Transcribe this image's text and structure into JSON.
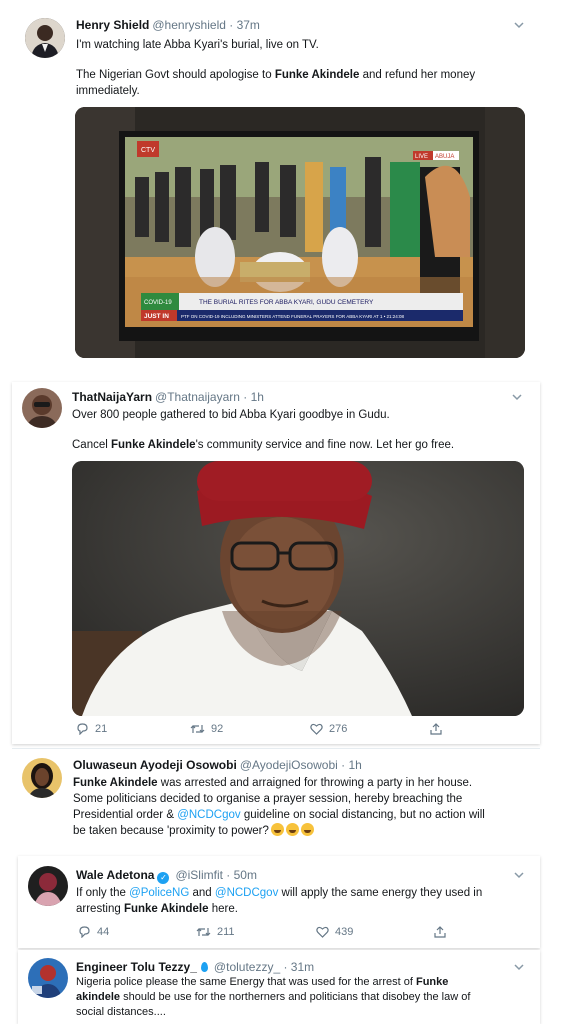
{
  "tweets": [
    {
      "name": "Henry Shield",
      "handle": "@henryshield · 37m",
      "p1": "I'm watching late Abba Kyari's burial, live on TV.",
      "p2_pre": "The Nigerian Govt should apologise to ",
      "p2_bold": "Funke Akindele",
      "p2_post": " and refund her money immediately.",
      "tv": {
        "channel": "CTV",
        "live_badge": "LIVE",
        "live_place": "ABUJA",
        "covid_tag": "COVID-19",
        "caption": "THE BURIAL RITES FOR ABBA KYARI, GUDU CEMETERY",
        "just_in": "JUST IN",
        "ticker": "PTF ON COVID-19 INCLUDING MINISTERS ATTEND FUNERAL PRAYERS FOR ABBA KYARI AT 1 • 21:24:08"
      }
    },
    {
      "name": "ThatNaijaYarn",
      "handle": "@Thatnaijayarn · 1h",
      "p1": "Over 800 people gathered to bid Abba Kyari goodbye in Gudu.",
      "p2_pre": "Cancel ",
      "p2_bold": "Funke Akindele",
      "p2_post": "'s community service and fine now. Let her go free.",
      "replies": "21",
      "retweets": "92",
      "likes": "276"
    },
    {
      "name": "Oluwaseun Ayodeji Osowobi",
      "handle": "@AyodejiOsowobi · 1h",
      "l1_bold": "Funke Akindele",
      "l1_rest": " was arrested and arraigned for throwing a party in her house.",
      "l2": "Some politicians decided to organise a prayer session, hereby breaching the",
      "l3_pre": "Presidential order & ",
      "l3_link": "@NCDCgov",
      "l3_post": " guideline on social distancing, but no action will",
      "l4": "be taken because 'proximity to power?"
    },
    {
      "name": "Wale Adetona",
      "handle": "@iSlimfit · 50m",
      "l1_pre": "If only the ",
      "l1_link1": "@PoliceNG",
      "l1_mid": " and ",
      "l1_link2": "@NCDCgov",
      "l1_post": " will apply the same energy they used in",
      "l2_pre": "arresting ",
      "l2_bold": "Funke Akindele",
      "l2_post": " here.",
      "replies": "44",
      "retweets": "211",
      "likes": "439"
    },
    {
      "name": "Engineer Tolu Tezzy_",
      "handle": "@tolutezzy_ · 31m",
      "l1_pre": "Nigeria police please the same Energy that was used for the arrest of ",
      "l1_bold": "Funke",
      "l2_bold": "akindele",
      "l2_post": " should be use  for the northerners and politicians that disobey the law of",
      "l3": "social distances...."
    }
  ],
  "icons": {
    "chevron": "chevron-down-icon",
    "reply": "reply-icon",
    "retweet": "retweet-icon",
    "like": "heart-icon",
    "share": "share-icon"
  },
  "colors": {
    "link": "#1da1f2",
    "muted": "#657786"
  }
}
